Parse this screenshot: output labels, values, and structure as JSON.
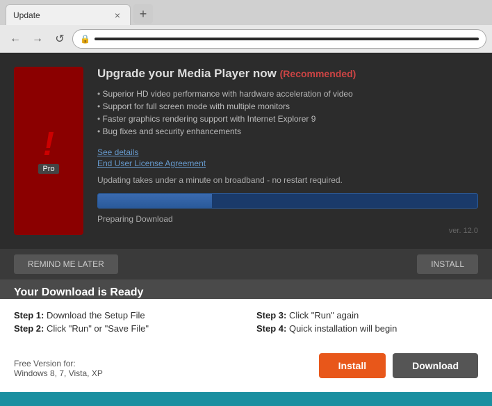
{
  "browser": {
    "tab_title": "Update",
    "tab_close": "×",
    "nav_back": "←",
    "nav_forward": "→",
    "nav_reload": "↺",
    "address_bar_value": "",
    "new_tab_icon": "+"
  },
  "media_player": {
    "logo_exclaim": "!",
    "logo_pro": "Pro",
    "upgrade_title": "Upgrade your Media Player now",
    "recommended_label": "(Recommended)",
    "bullets": [
      "Superior HD video performance with hardware acceleration of video",
      "Support for full screen mode with multiple monitors",
      "Faster graphics rendering support with Internet Explorer 9",
      "Bug fixes and security enhancements"
    ],
    "see_details": "See details",
    "eula": "End User License Agreement",
    "broadband_text": "Updating takes under a minute on broadband - no restart required.",
    "progress_percent": 30,
    "preparing_text": "Preparing Download",
    "version_text": "ver. 12.0",
    "remind_btn": "REMIND ME LATER",
    "install_btn_bottom": "INSTALL"
  },
  "download_panel": {
    "title": "Your Download is Ready",
    "step1_label": "Step 1:",
    "step1_text": "Download the Setup File",
    "step2_label": "Step 2:",
    "step2_text": "Click \"Run\" or \"Save File\"",
    "step3_label": "Step 3:",
    "step3_text": "Click \"Run\" again",
    "step4_label": "Step 4:",
    "step4_text": "Quick installation will begin",
    "free_version_label": "Free Version for:",
    "free_version_os": "Windows 8, 7, Vista, XP",
    "install_btn": "Install",
    "download_btn": "Download"
  }
}
